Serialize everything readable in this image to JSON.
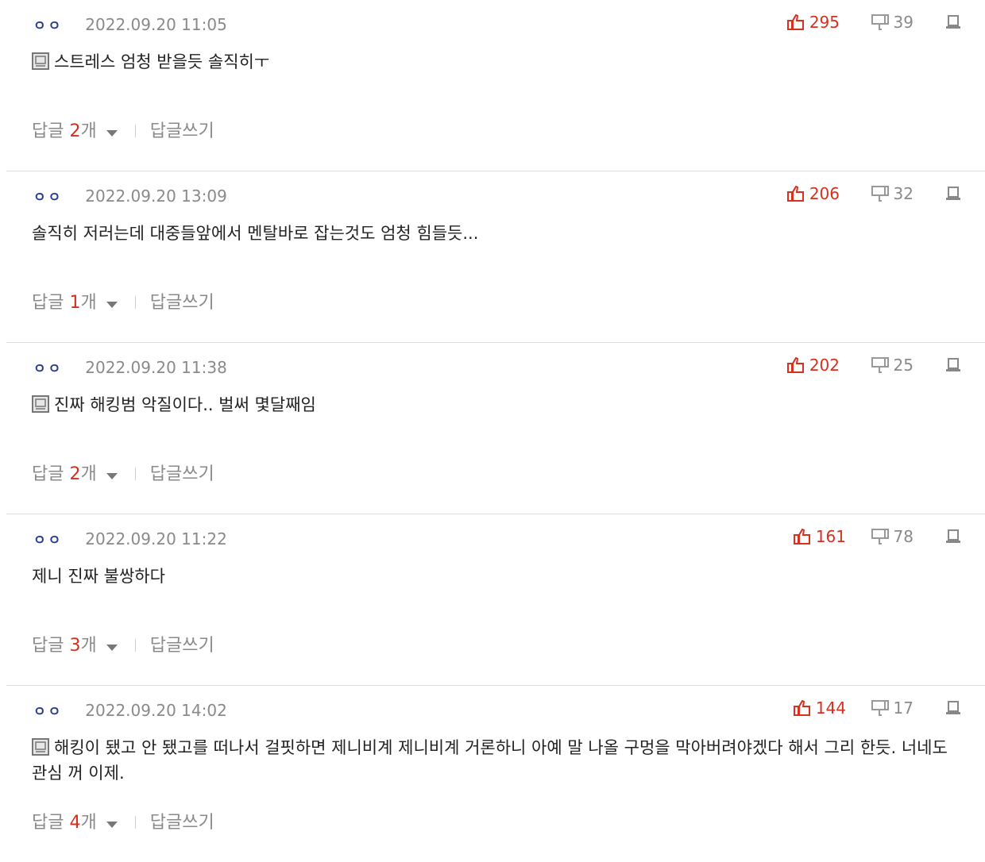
{
  "colors": {
    "accent": "#d6301f",
    "muted": "#8a8a8a",
    "nick": "#2a3a8c"
  },
  "icons": {
    "like": "thumbs-up-icon",
    "dislike": "thumbs-down-icon",
    "report": "report-icon",
    "memo": "memo-icon",
    "dropdown": "chevron-down-icon"
  },
  "labels": {
    "reply": "답글",
    "reply_unit": "개",
    "write_reply": "답글쓰기"
  },
  "comments": [
    {
      "nick": "ㅇㅇ",
      "date": "2022.09.20 11:05",
      "likes": "295",
      "dislikes": "39",
      "text": "스트레스 엄청 받을듯 솔직히ㅜ",
      "has_memo": true,
      "replies": "2"
    },
    {
      "nick": "ㅇㅇ",
      "date": "2022.09.20 13:09",
      "likes": "206",
      "dislikes": "32",
      "text": "솔직히 저러는데 대중들앞에서 멘탈바로 잡는것도 엄청 힘들듯...",
      "has_memo": false,
      "replies": "1"
    },
    {
      "nick": "ㅇㅇ",
      "date": "2022.09.20 11:38",
      "likes": "202",
      "dislikes": "25",
      "text": "진짜 해킹범 악질이다.. 벌써 몇달째임",
      "has_memo": true,
      "replies": "2"
    },
    {
      "nick": "ㅇㅇ",
      "date": "2022.09.20 11:22",
      "likes": "161",
      "dislikes": "78",
      "text": "제니 진짜 불쌍하다",
      "has_memo": false,
      "replies": "3"
    },
    {
      "nick": "ㅇㅇ",
      "date": "2022.09.20 14:02",
      "likes": "144",
      "dislikes": "17",
      "text": "해킹이 됐고 안 됐고를 떠나서 걸핏하면 제니비계 제니비계 거론하니 아예 말 나올 구멍을 막아버려야겠다 해서 그리 한듯. 너네도 관심 꺼 이제.",
      "has_memo": true,
      "replies": "4"
    }
  ]
}
